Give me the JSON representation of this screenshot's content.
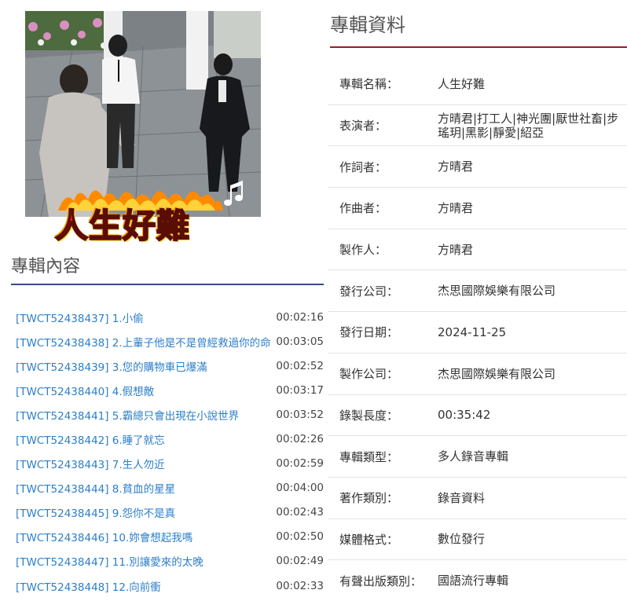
{
  "cover": {
    "title_art": "人生好難",
    "note_icon": "music-note-icon"
  },
  "tracks_section": {
    "title": "專輯內容",
    "tracks": [
      {
        "name": "[TWCT52438437] 1.小偷",
        "time": "00:02:16"
      },
      {
        "name": "[TWCT52438438] 2.上輩子他是不是曾經救過你的命",
        "time": "00:03:05"
      },
      {
        "name": "[TWCT52438439] 3.您的購物車已爆滿",
        "time": "00:02:52"
      },
      {
        "name": "[TWCT52438440] 4.假想敵",
        "time": "00:03:17"
      },
      {
        "name": "[TWCT52438441] 5.霸總只會出現在小說世界",
        "time": "00:03:52"
      },
      {
        "name": "[TWCT52438442] 6.睡了就忘",
        "time": "00:02:26"
      },
      {
        "name": "[TWCT52438443] 7.生人勿近",
        "time": "00:02:59"
      },
      {
        "name": "[TWCT52438444] 8.貧血的星星",
        "time": "00:04:00"
      },
      {
        "name": "[TWCT52438445] 9.怨你不是真",
        "time": "00:02:43"
      },
      {
        "name": "[TWCT52438446] 10.妳會想起我嗎",
        "time": "00:02:50"
      },
      {
        "name": "[TWCT52438447] 11.別讓愛來的太晚",
        "time": "00:02:49"
      },
      {
        "name": "[TWCT52438448] 12.向前衝",
        "time": "00:02:33"
      }
    ]
  },
  "info_section": {
    "title": "專輯資料",
    "rows": [
      {
        "label": "專輯名稱：",
        "value": "人生好難"
      },
      {
        "label": "表演者：",
        "value": "方晴君|打工人|神光團|厭世社畜|步瑤玥|黑影|靜愛|紹亞"
      },
      {
        "label": "作詞者：",
        "value": "方晴君"
      },
      {
        "label": "作曲者：",
        "value": "方晴君"
      },
      {
        "label": "製作人：",
        "value": "方晴君"
      },
      {
        "label": "發行公司：",
        "value": "杰思國際娛樂有限公司"
      },
      {
        "label": "發行日期：",
        "value": "2024-11-25"
      },
      {
        "label": "製作公司：",
        "value": "杰思國際娛樂有限公司"
      },
      {
        "label": "錄製長度：",
        "value": "00:35:42"
      },
      {
        "label": "專輯類型：",
        "value": "多人錄音專輯"
      },
      {
        "label": "著作類別：",
        "value": "錄音資料"
      },
      {
        "label": "媒體格式：",
        "value": "數位發行"
      },
      {
        "label": "有聲出版類別：",
        "value": "國語流行專輯"
      }
    ]
  },
  "colors": {
    "link": "#2c7fc9",
    "left_rule": "#3a4a86",
    "right_rule": "#9b1b27"
  }
}
